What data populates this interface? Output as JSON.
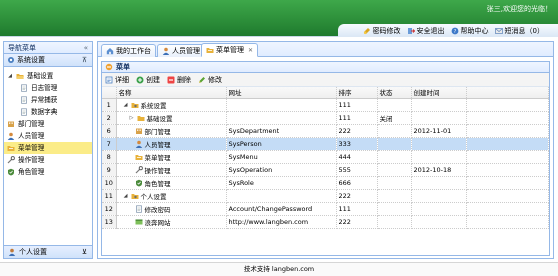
{
  "header": {
    "greeting": "张三,欢迎您的光临！",
    "links": [
      {
        "label": "密码修改",
        "icon": "key-icon"
      },
      {
        "label": "安全退出",
        "icon": "logout-icon"
      },
      {
        "label": "帮助中心",
        "icon": "help-icon"
      },
      {
        "label": "短消息（0）",
        "icon": "message-icon"
      }
    ]
  },
  "nav": {
    "title": "导航菜单",
    "collapse_glyph": "«",
    "section": "系统设置",
    "section_toggle": "⊼",
    "tree": [
      {
        "label": "基础设置",
        "level": 0,
        "arrow": "◢",
        "icon": "folder-open-icon"
      },
      {
        "label": "日志管理",
        "level": 1,
        "icon": "document-icon"
      },
      {
        "label": "异常捕获",
        "level": 1,
        "icon": "document-icon"
      },
      {
        "label": "数据字典",
        "level": 1,
        "icon": "document-icon"
      },
      {
        "label": "部门管理",
        "level": 0,
        "icon": "department-icon"
      },
      {
        "label": "人员管理",
        "level": 0,
        "icon": "person-icon"
      },
      {
        "label": "菜单管理",
        "level": 0,
        "icon": "menu-folder-icon",
        "selected": true
      },
      {
        "label": "操作管理",
        "level": 0,
        "icon": "operation-icon"
      },
      {
        "label": "角色管理",
        "level": 0,
        "icon": "role-icon"
      }
    ],
    "personal": "个人设置",
    "personal_toggle": "⊻"
  },
  "tabs": [
    {
      "label": "我的工作台",
      "icon": "home-icon",
      "closable": false
    },
    {
      "label": "人员管理",
      "icon": "person-icon",
      "closable": true
    },
    {
      "label": "菜单管理",
      "icon": "menu-folder-icon",
      "closable": true,
      "active": true
    }
  ],
  "panel": {
    "title": "菜单",
    "toolbar": [
      {
        "label": "详细",
        "icon": "detail-icon"
      },
      {
        "label": "创建",
        "icon": "add-icon"
      },
      {
        "label": "删除",
        "icon": "delete-icon"
      },
      {
        "label": "修改",
        "icon": "edit-icon"
      }
    ]
  },
  "grid": {
    "columns": [
      "名称",
      "网址",
      "排序",
      "状态",
      "创建时间"
    ],
    "rows": [
      {
        "n": "1",
        "name": "系统设置",
        "url": "",
        "sort": "111",
        "status": "",
        "created": "",
        "indent": 0,
        "arrow": "◢",
        "icon": "settings-folder-icon"
      },
      {
        "n": "2",
        "name": "基础设置",
        "url": "",
        "sort": "111",
        "status": "关闭",
        "created": "",
        "indent": 1,
        "arrow": "▷",
        "icon": "folder-icon"
      },
      {
        "n": "6",
        "name": "部门管理",
        "url": "SysDepartment",
        "sort": "222",
        "status": "",
        "created": "2012-11-01",
        "indent": 1,
        "arrow": "",
        "icon": "department-icon"
      },
      {
        "n": "7",
        "name": "人员管理",
        "url": "SysPerson",
        "sort": "333",
        "status": "",
        "created": "",
        "indent": 1,
        "arrow": "",
        "icon": "person-icon",
        "selected": true
      },
      {
        "n": "8",
        "name": "菜单管理",
        "url": "SysMenu",
        "sort": "444",
        "status": "",
        "created": "",
        "indent": 1,
        "arrow": "",
        "icon": "menu-folder-icon"
      },
      {
        "n": "9",
        "name": "操作管理",
        "url": "SysOperation",
        "sort": "555",
        "status": "",
        "created": "2012-10-18",
        "indent": 1,
        "arrow": "",
        "icon": "operation-icon"
      },
      {
        "n": "10",
        "name": "角色管理",
        "url": "SysRole",
        "sort": "666",
        "status": "",
        "created": "",
        "indent": 1,
        "arrow": "",
        "icon": "role-icon"
      },
      {
        "n": "11",
        "name": "个人设置",
        "url": "",
        "sort": "222",
        "status": "",
        "created": "",
        "indent": 0,
        "arrow": "◢",
        "icon": "settings-folder-icon"
      },
      {
        "n": "12",
        "name": "修改密码",
        "url": "Account/ChangePassword",
        "sort": "111",
        "status": "",
        "created": "",
        "indent": 1,
        "arrow": "",
        "icon": "document-icon"
      },
      {
        "n": "13",
        "name": "浪奔网站",
        "url": "http://www.langben.com",
        "sort": "222",
        "status": "",
        "created": "",
        "indent": 1,
        "arrow": "",
        "icon": "web-icon"
      }
    ]
  },
  "footer": "技术支持 langben.com",
  "colors": {
    "header_green": "#2d8f3a",
    "selection_blue": "#c4dcf6",
    "nav_selected": "#fbec88",
    "border": "#95b8e7"
  }
}
